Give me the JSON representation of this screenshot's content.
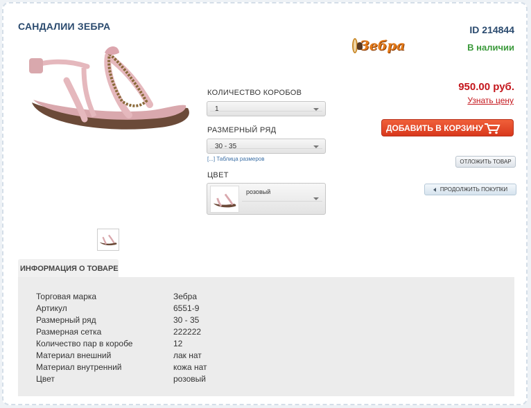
{
  "product": {
    "title": "САНДАЛИИ ЗЕБРА",
    "id": "ID 214844",
    "brand_logo_text": "Зебра",
    "stock_status": "В наличии",
    "price": "950.00 руб.",
    "ask_price_link": "Узнать цену"
  },
  "options": {
    "boxes": {
      "label": "КОЛИЧЕСТВО КОРОБОВ",
      "value": "1"
    },
    "size_range": {
      "label": "РАЗМЕРНЫЙ РЯД",
      "value": "30 - 35",
      "size_table_link": "[...] Таблица размеров"
    },
    "color": {
      "label": "ЦВЕТ",
      "value": "розовый"
    }
  },
  "buttons": {
    "add_to_cart": "ДОБАВИТЬ В КОРЗИНУ",
    "defer": "ОТЛОЖИТЬ ТОВАР",
    "continue_shopping": "ПРОДОЛЖИТЬ ПОКУПКИ"
  },
  "info": {
    "tab_label": "ИНФОРМАЦИЯ О ТОВАРЕ",
    "specs": [
      {
        "key": "Торговая марка",
        "value": "Зебра"
      },
      {
        "key": "Артикул",
        "value": "6551-9"
      },
      {
        "key": "Размерный ряд",
        "value": "30 - 35"
      },
      {
        "key": "Размерная сетка",
        "value": "222222"
      },
      {
        "key": "Количество пар в коробе",
        "value": "12"
      },
      {
        "key": "Материал внешний",
        "value": "лак нат"
      },
      {
        "key": "Материал внутренний",
        "value": "кожа нат"
      },
      {
        "key": "Цвет",
        "value": "розовый"
      }
    ]
  },
  "colors": {
    "title": "#2a4a6e",
    "price": "#c4161c",
    "in_stock": "#3c9a3c",
    "cart_button": "#e4492a",
    "info_panel": "#ececec"
  }
}
